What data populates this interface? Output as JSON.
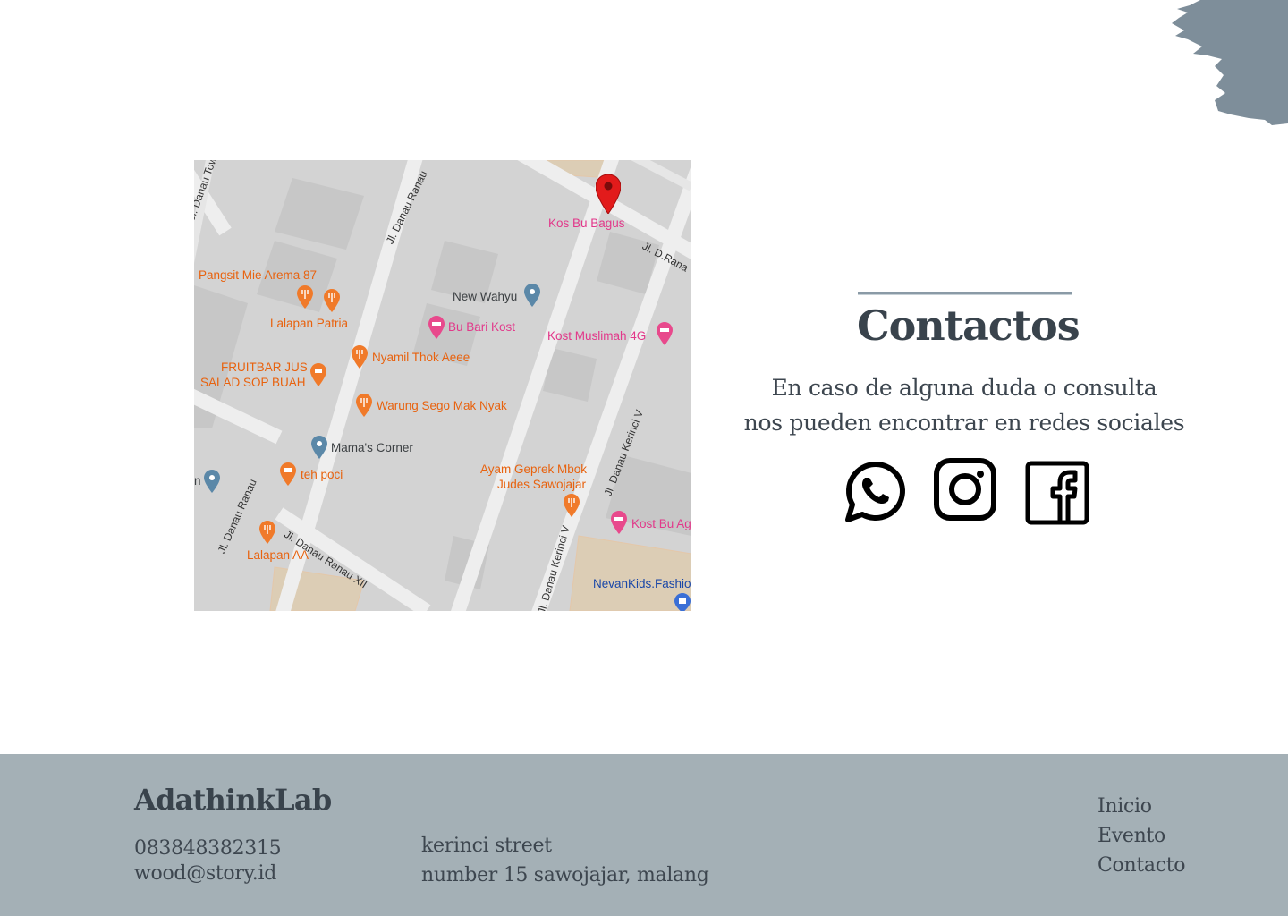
{
  "colors": {
    "accent": "#7e8e9a",
    "heading": "#39434c",
    "text": "#3d464f",
    "footer_bg": "#a4b0b6",
    "map_bg": "#d3d3d3"
  },
  "decor": {
    "icon": "paint-brush-stroke"
  },
  "map": {
    "markers": {
      "main": {
        "label": "Kos Bu Bagus",
        "icon": "red-location-pin-icon"
      }
    },
    "places": [
      {
        "label": "Pangsit Mie Arema 87",
        "icon": "restaurant-icon"
      },
      {
        "label": "Lalapan Patria",
        "icon": "restaurant-icon"
      },
      {
        "label": "New Wahyu",
        "icon": "location-pin-icon"
      },
      {
        "label": "Bu Bari Kost",
        "icon": "hotel-icon"
      },
      {
        "label": "Kost Muslimah 4G",
        "icon": "hotel-icon"
      },
      {
        "label": "Nyamil Thok Aeee",
        "icon": "restaurant-icon"
      },
      {
        "label": "FRUITBAR JUS",
        "icon": "cafe-icon"
      },
      {
        "label": "SALAD SOP BUAH",
        "icon": "cafe-icon"
      },
      {
        "label": "Warung Sego Mak Nyak",
        "icon": "restaurant-icon"
      },
      {
        "label": "Mama's Corner",
        "icon": "location-pin-icon"
      },
      {
        "label": "teh poci",
        "icon": "cafe-icon"
      },
      {
        "label": "Ayam Geprek Mbok",
        "icon": "restaurant-icon"
      },
      {
        "label": "Judes Sawojajar",
        "icon": "restaurant-icon"
      },
      {
        "label": "Kost Bu Ag",
        "icon": "hotel-icon"
      },
      {
        "label": "Lalapan AA",
        "icon": "restaurant-icon"
      },
      {
        "label": "NevanKids.Fashio",
        "icon": "shopping-icon"
      },
      {
        "label": "n",
        "icon": "location-pin-icon"
      }
    ],
    "streets": [
      "Jl. Danau Towu",
      "Jl. Danau Ranau",
      "Jl. D.Rana",
      "Jl. Danau Kerinci V",
      "Jl. Danau Ranau",
      "Jl. Danau Ranau XII",
      "Jl. Danau Kerinci V"
    ]
  },
  "contact": {
    "title": "Contactos",
    "lines": [
      "En caso de alguna duda o consulta",
      "nos pueden encontrar en redes  sociales"
    ],
    "social": [
      {
        "icon": "whatsapp-icon"
      },
      {
        "icon": "instagram-icon"
      },
      {
        "icon": "facebook-icon"
      }
    ]
  },
  "footer": {
    "brand": "AdathinkLab",
    "phone": "083848382315",
    "email": "wood@story.id",
    "address_line1": "kerinci street",
    "address_line2": "number 15 sawojajar, malang",
    "nav": [
      "Inicio",
      "Evento",
      "Contacto"
    ]
  }
}
